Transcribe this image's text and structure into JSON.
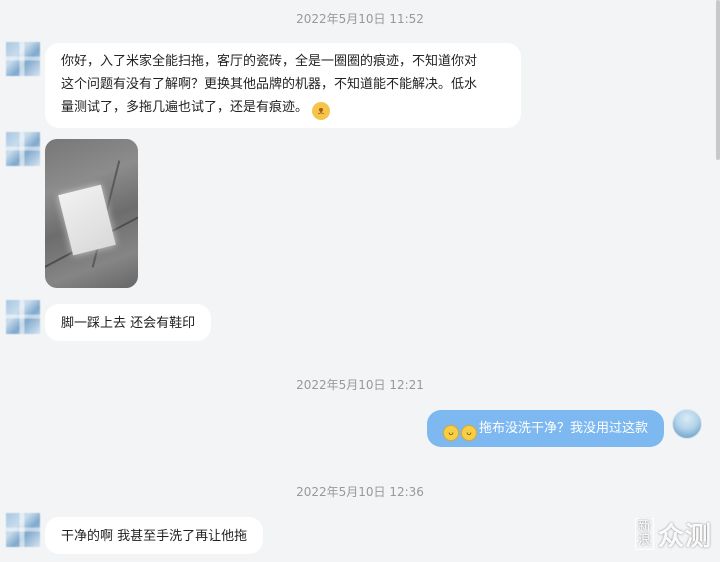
{
  "timestamps": [
    "2022年5月10日 11:52",
    "2022年5月10日 12:21",
    "2022年5月10日 12:36"
  ],
  "messages": {
    "m1_line1": "你好，入了米家全能扫拖，客厅的瓷砖，全是一圈圈的痕迹，不知道你对",
    "m1_line2": "这个问题有没有了解啊？更换其他品牌的机器，不知道能不能解决。低水",
    "m1_line3": "量测试了，多拖几遍也试了，还是有痕迹。",
    "m2": "脚一踩上去 还会有鞋印",
    "m3": "拖布没洗干净？我没用过这款",
    "m4": "干净的啊 我甚至手洗了再让他拖"
  },
  "watermark": {
    "stack_top": "新",
    "stack_bottom": "浪",
    "brand": "众测"
  },
  "icons": [
    "cat-emoji-icon",
    "laughing-emoji-icon",
    "scrollbar"
  ],
  "colors": {
    "background": "#f3f4f6",
    "incoming_bubble": "#ffffff",
    "outgoing_bubble": "#7db8f0",
    "timestamp": "#999999"
  }
}
